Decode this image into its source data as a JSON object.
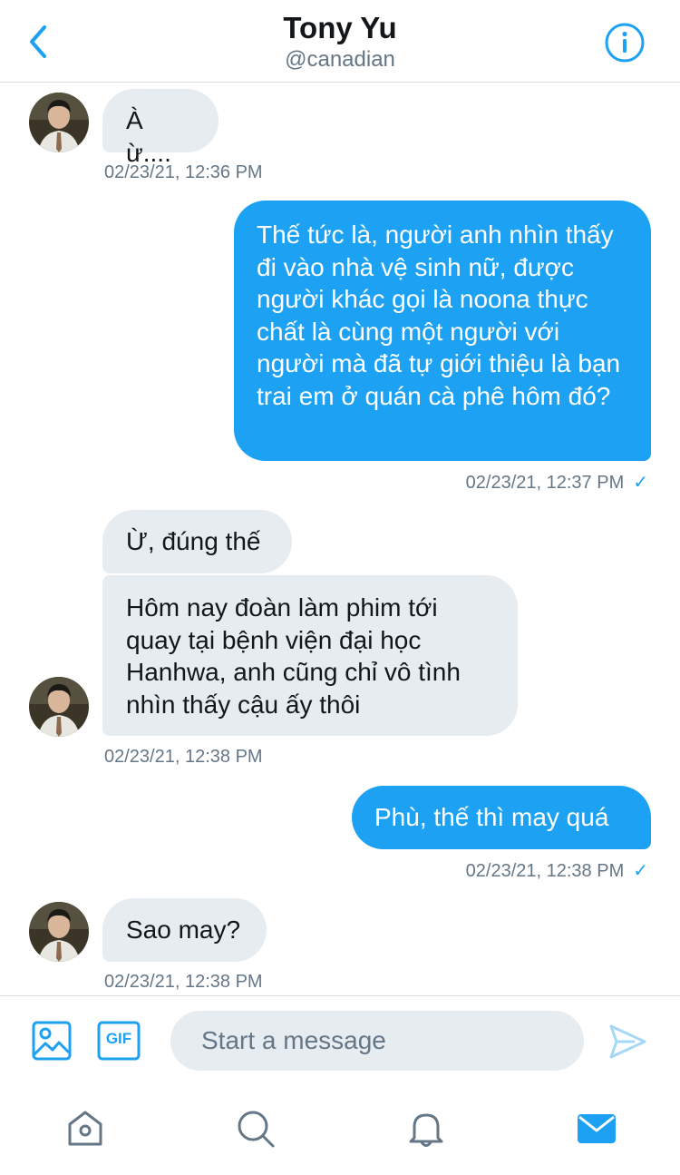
{
  "header": {
    "name": "Tony Yu",
    "handle": "@canadian"
  },
  "icons": {
    "back": "chevron-left-icon",
    "info": "info-icon",
    "image": "image-icon",
    "gif": "gif-icon",
    "send": "send-icon",
    "home": "home-icon",
    "search": "search-icon",
    "notifications": "bell-icon",
    "messages": "mail-icon"
  },
  "colors": {
    "accent": "#1da1f2",
    "incoming_bubble": "#e6ecf0",
    "secondary_text": "#657786"
  },
  "messages": [
    {
      "direction": "incoming",
      "text": "À ừ....",
      "timestamp": "02/23/21, 12:36 PM"
    },
    {
      "direction": "outgoing",
      "text": "Thế tức là, người anh nhìn thấy đi vào nhà vệ sinh nữ, được người khác gọi là noona thực chất là cùng một người với người mà đã tự giới thiệu là bạn trai em ở quán cà phê hôm đó?",
      "timestamp": "02/23/21, 12:37 PM",
      "seen": "✓"
    },
    {
      "direction": "incoming",
      "text": "Ừ, đúng thế"
    },
    {
      "direction": "incoming",
      "text": "Hôm nay đoàn làm phim tới quay tại bệnh viện đại học Hanhwa, anh cũng chỉ vô tình nhìn thấy cậu ấy thôi",
      "timestamp": "02/23/21, 12:38 PM"
    },
    {
      "direction": "outgoing",
      "text": "Phù, thế thì may quá",
      "timestamp": "02/23/21, 12:38 PM",
      "seen": "✓"
    },
    {
      "direction": "incoming",
      "text": "Sao may?",
      "timestamp": "02/23/21, 12:38 PM"
    }
  ],
  "composer": {
    "placeholder": "Start a message",
    "gif_label": "GIF"
  }
}
